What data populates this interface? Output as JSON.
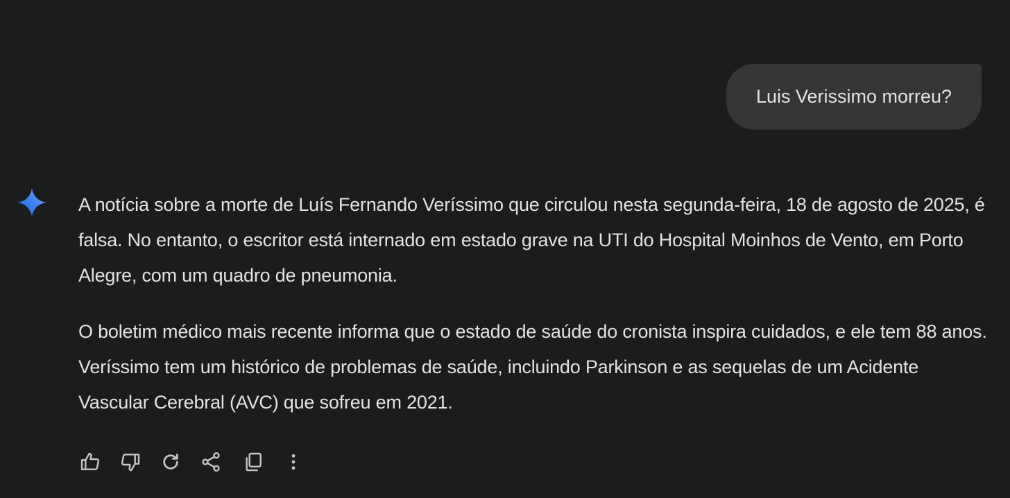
{
  "user_message": {
    "text": "Luis Verissimo morreu?"
  },
  "assistant": {
    "icon": "sparkle-icon",
    "accent_colors": [
      "#4285f4",
      "#1a73e8",
      "#6ea8ff"
    ],
    "paragraphs": [
      "A notícia sobre a morte de Luís Fernando Veríssimo que circulou nesta segunda-feira, 18 de agosto de 2025, é falsa. No entanto, o escritor está internado em estado grave na UTI do Hospital Moinhos de Vento, em Porto Alegre, com um quadro de pneumonia.",
      "O boletim médico mais recente informa que o estado de saúde do cronista inspira cuidados, e ele tem 88 anos. Veríssimo tem um histórico de problemas de saúde, incluindo Parkinson e as sequelas de um Acidente Vascular Cerebral (AVC) que sofreu em 2021."
    ]
  },
  "actions": [
    {
      "name": "thumbs-up",
      "icon": "thumbs-up-icon"
    },
    {
      "name": "thumbs-down",
      "icon": "thumbs-down-icon"
    },
    {
      "name": "regenerate",
      "icon": "refresh-icon"
    },
    {
      "name": "share",
      "icon": "share-icon"
    },
    {
      "name": "copy",
      "icon": "copy-icon"
    },
    {
      "name": "more",
      "icon": "more-vertical-icon"
    }
  ],
  "colors": {
    "background": "#1b1c1e",
    "bubble": "#333537",
    "text": "#e3e3e3",
    "icon": "#c4c7c5"
  }
}
